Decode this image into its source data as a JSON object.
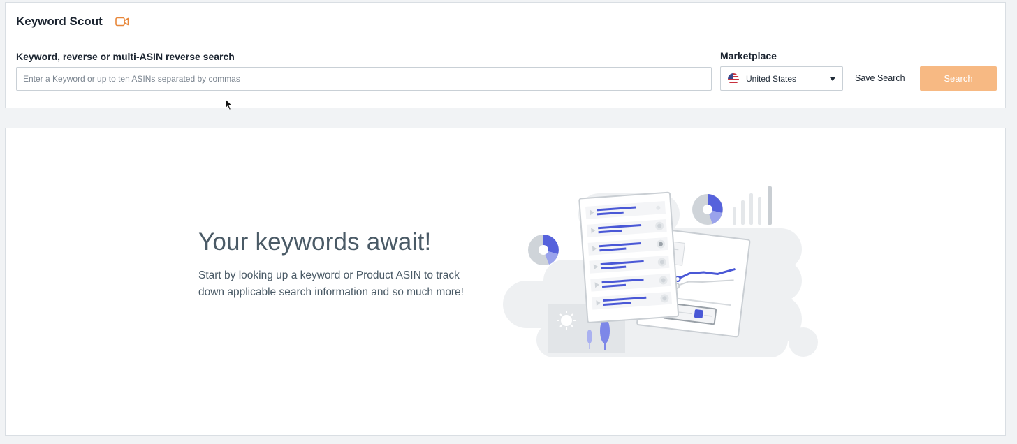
{
  "header": {
    "title": "Keyword Scout",
    "video_icon": "video-camera-icon"
  },
  "search": {
    "label": "Keyword, reverse or multi-ASIN reverse search",
    "placeholder": "Enter a Keyword or up to ten ASINs separated by commas",
    "value": ""
  },
  "marketplace": {
    "label": "Marketplace",
    "selected": "United States",
    "flag_icon": "us-flag-icon"
  },
  "actions": {
    "save_search_label": "Save Search",
    "search_label": "Search"
  },
  "empty_state": {
    "heading": "Your keywords await!",
    "body": "Start by looking up a keyword or Product ASIN to track down applicable search information and so much more!"
  },
  "colors": {
    "accent": "#f7b983",
    "video_icon": "#e8873a",
    "illustration_blue": "#4a58d6"
  }
}
